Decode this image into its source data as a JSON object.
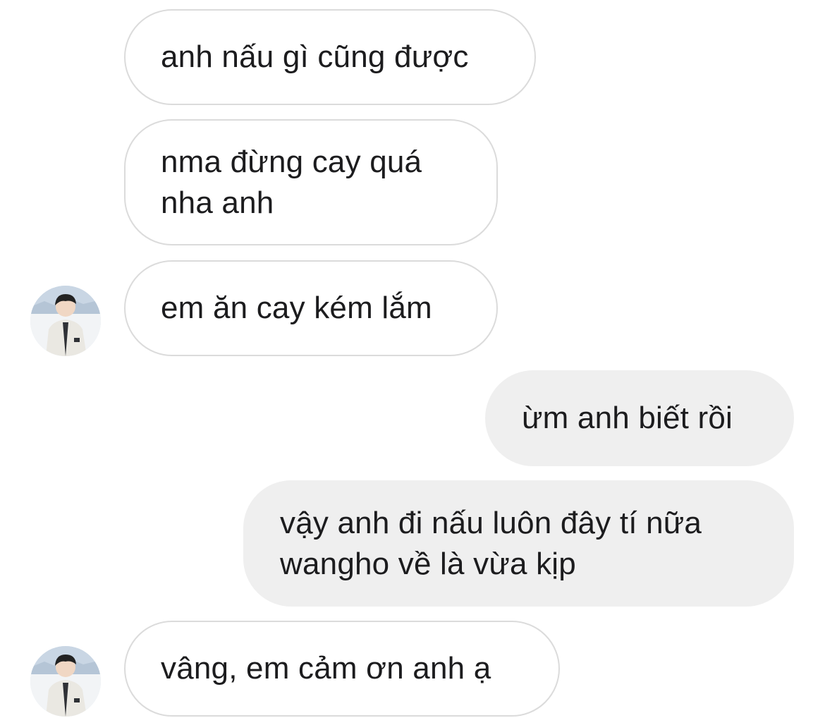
{
  "conversation": {
    "messages": [
      {
        "direction": "incoming",
        "lines": [
          "anh nấu gì cũng được"
        ]
      },
      {
        "direction": "incoming",
        "lines": [
          "nma đừng cay quá",
          "nha anh"
        ]
      },
      {
        "direction": "incoming",
        "lines": [
          "em ăn cay kém lắm"
        ]
      },
      {
        "direction": "outgoing",
        "lines": [
          "ừm anh biết rồi"
        ]
      },
      {
        "direction": "outgoing",
        "lines": [
          "vậy anh đi nấu luôn đây tí nữa",
          "wangho về là vừa kịp"
        ]
      },
      {
        "direction": "incoming",
        "lines": [
          "vâng, em cảm ơn anh ạ"
        ]
      }
    ]
  },
  "avatar": {
    "icon": "person-photo-icon"
  },
  "colors": {
    "incoming_bubble_bg": "#ffffff",
    "incoming_bubble_border": "#dbdbdb",
    "outgoing_bubble_bg": "#efefef",
    "text": "#1c1c1e"
  }
}
